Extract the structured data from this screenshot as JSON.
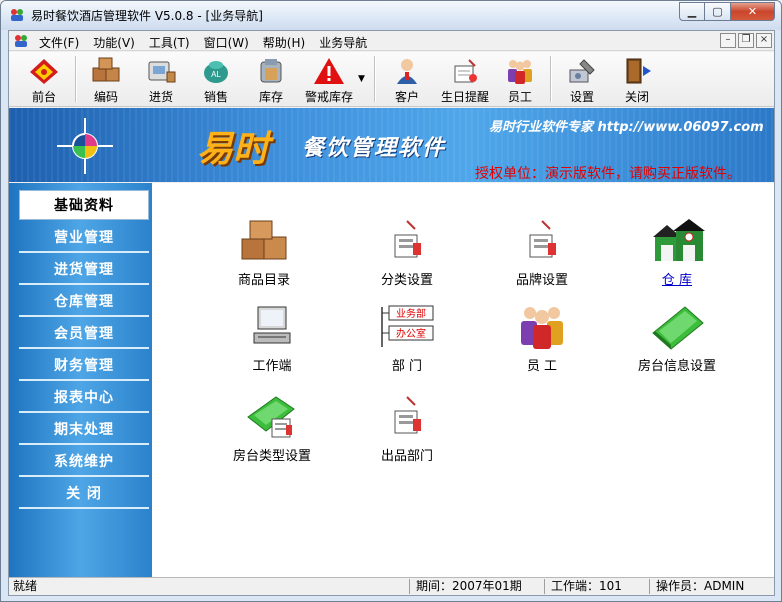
{
  "window": {
    "title": "易时餐饮酒店管理软件 V5.0.8 - [业务导航]"
  },
  "menu": {
    "items": [
      "文件(F)",
      "功能(V)",
      "工具(T)",
      "窗口(W)",
      "帮助(H)",
      "业务导航"
    ]
  },
  "toolbar": {
    "buttons": [
      {
        "label": "前台",
        "icon": "front-desk-icon"
      },
      {
        "label": "编码",
        "icon": "boxes-icon"
      },
      {
        "label": "进货",
        "icon": "purchase-icon"
      },
      {
        "label": "销售",
        "icon": "sales-icon"
      },
      {
        "label": "库存",
        "icon": "inventory-icon"
      },
      {
        "label": "警戒库存",
        "icon": "warning-icon"
      },
      {
        "label": "客户",
        "icon": "customer-icon"
      },
      {
        "label": "生日提醒",
        "icon": "birthday-icon"
      },
      {
        "label": "员工",
        "icon": "staff-icon"
      },
      {
        "label": "设置",
        "icon": "settings-icon"
      },
      {
        "label": "关闭",
        "icon": "exit-door-icon"
      }
    ]
  },
  "banner": {
    "brand_big": "易时",
    "brand_sub": "餐饮管理软件",
    "tagline": "易时行业软件专家 http://www.06097.com",
    "license": "授权单位：演示版软件，请购买正版软件。"
  },
  "sidenav": {
    "items": [
      "基础资料",
      "营业管理",
      "进货管理",
      "仓库管理",
      "会员管理",
      "财务管理",
      "报表中心",
      "期末处理",
      "系统维护",
      "关    闭"
    ]
  },
  "main": {
    "tiles": [
      {
        "label": "商品目录"
      },
      {
        "label": "分类设置"
      },
      {
        "label": "品牌设置"
      },
      {
        "label": "仓  库"
      },
      {
        "label": "工作端"
      },
      {
        "label": "部  门",
        "icon_text_1": "业务部",
        "icon_text_2": "办公室"
      },
      {
        "label": "员  工"
      },
      {
        "label": "房台信息设置"
      },
      {
        "label": "房台类型设置"
      },
      {
        "label": "出品部门"
      }
    ]
  },
  "status": {
    "ready": "就绪",
    "period": "期间：2007年01期",
    "terminal": "工作端：101",
    "operator": "操作员：ADMIN"
  },
  "colors": {
    "nav_blue": "#3d8fdc",
    "license_red": "#e00000",
    "brand_orange": "#ffb11a"
  }
}
